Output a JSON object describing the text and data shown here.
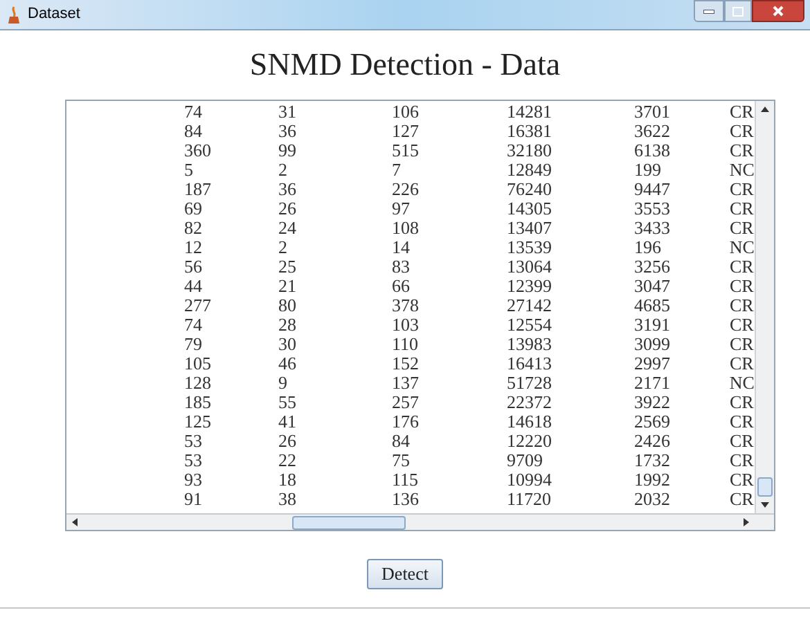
{
  "window": {
    "title": "Dataset"
  },
  "heading": "SNMD Detection - Data",
  "table": {
    "rows": [
      [
        "74",
        "31",
        "106",
        "14281",
        "3701",
        "CR"
      ],
      [
        "84",
        "36",
        "127",
        "16381",
        "3622",
        "CR"
      ],
      [
        "360",
        "99",
        "515",
        "32180",
        "6138",
        "CR"
      ],
      [
        "5",
        "2",
        "7",
        "12849",
        "199",
        "NC"
      ],
      [
        "187",
        "36",
        "226",
        "76240",
        "9447",
        "CR"
      ],
      [
        "69",
        "26",
        "97",
        "14305",
        "3553",
        "CR"
      ],
      [
        "82",
        "24",
        "108",
        "13407",
        "3433",
        "CR"
      ],
      [
        "12",
        "2",
        "14",
        "13539",
        "196",
        "NC"
      ],
      [
        "56",
        "25",
        "83",
        "13064",
        "3256",
        "CR"
      ],
      [
        "44",
        "21",
        "66",
        "12399",
        "3047",
        "CR"
      ],
      [
        "277",
        "80",
        "378",
        "27142",
        "4685",
        "CR"
      ],
      [
        "74",
        "28",
        "103",
        "12554",
        "3191",
        "CR"
      ],
      [
        "79",
        "30",
        "110",
        "13983",
        "3099",
        "CR"
      ],
      [
        "105",
        "46",
        "152",
        "16413",
        "2997",
        "CR"
      ],
      [
        "128",
        "9",
        "137",
        "51728",
        "2171",
        "NC"
      ],
      [
        "185",
        "55",
        "257",
        "22372",
        "3922",
        "CR"
      ],
      [
        "125",
        "41",
        "176",
        "14618",
        "2569",
        "CR"
      ],
      [
        "53",
        "26",
        "84",
        "12220",
        "2426",
        "CR"
      ],
      [
        "53",
        "22",
        "75",
        "9709",
        "1732",
        "CR"
      ],
      [
        "93",
        "18",
        "115",
        "10994",
        "1992",
        "CR"
      ],
      [
        "91",
        "38",
        "136",
        "11720",
        "2032",
        "CR"
      ]
    ]
  },
  "button": {
    "label": "Detect"
  }
}
